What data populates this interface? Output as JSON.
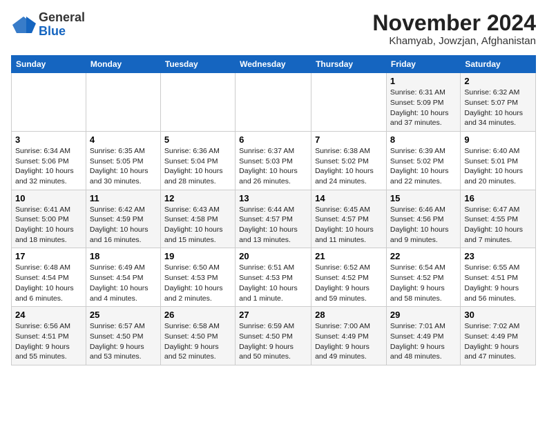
{
  "logo": {
    "general": "General",
    "blue": "Blue"
  },
  "header": {
    "month": "November 2024",
    "location": "Khamyab, Jowzjan, Afghanistan"
  },
  "weekdays": [
    "Sunday",
    "Monday",
    "Tuesday",
    "Wednesday",
    "Thursday",
    "Friday",
    "Saturday"
  ],
  "weeks": [
    [
      {
        "day": "",
        "info": ""
      },
      {
        "day": "",
        "info": ""
      },
      {
        "day": "",
        "info": ""
      },
      {
        "day": "",
        "info": ""
      },
      {
        "day": "",
        "info": ""
      },
      {
        "day": "1",
        "info": "Sunrise: 6:31 AM\nSunset: 5:09 PM\nDaylight: 10 hours and 37 minutes."
      },
      {
        "day": "2",
        "info": "Sunrise: 6:32 AM\nSunset: 5:07 PM\nDaylight: 10 hours and 34 minutes."
      }
    ],
    [
      {
        "day": "3",
        "info": "Sunrise: 6:34 AM\nSunset: 5:06 PM\nDaylight: 10 hours and 32 minutes."
      },
      {
        "day": "4",
        "info": "Sunrise: 6:35 AM\nSunset: 5:05 PM\nDaylight: 10 hours and 30 minutes."
      },
      {
        "day": "5",
        "info": "Sunrise: 6:36 AM\nSunset: 5:04 PM\nDaylight: 10 hours and 28 minutes."
      },
      {
        "day": "6",
        "info": "Sunrise: 6:37 AM\nSunset: 5:03 PM\nDaylight: 10 hours and 26 minutes."
      },
      {
        "day": "7",
        "info": "Sunrise: 6:38 AM\nSunset: 5:02 PM\nDaylight: 10 hours and 24 minutes."
      },
      {
        "day": "8",
        "info": "Sunrise: 6:39 AM\nSunset: 5:02 PM\nDaylight: 10 hours and 22 minutes."
      },
      {
        "day": "9",
        "info": "Sunrise: 6:40 AM\nSunset: 5:01 PM\nDaylight: 10 hours and 20 minutes."
      }
    ],
    [
      {
        "day": "10",
        "info": "Sunrise: 6:41 AM\nSunset: 5:00 PM\nDaylight: 10 hours and 18 minutes."
      },
      {
        "day": "11",
        "info": "Sunrise: 6:42 AM\nSunset: 4:59 PM\nDaylight: 10 hours and 16 minutes."
      },
      {
        "day": "12",
        "info": "Sunrise: 6:43 AM\nSunset: 4:58 PM\nDaylight: 10 hours and 15 minutes."
      },
      {
        "day": "13",
        "info": "Sunrise: 6:44 AM\nSunset: 4:57 PM\nDaylight: 10 hours and 13 minutes."
      },
      {
        "day": "14",
        "info": "Sunrise: 6:45 AM\nSunset: 4:57 PM\nDaylight: 10 hours and 11 minutes."
      },
      {
        "day": "15",
        "info": "Sunrise: 6:46 AM\nSunset: 4:56 PM\nDaylight: 10 hours and 9 minutes."
      },
      {
        "day": "16",
        "info": "Sunrise: 6:47 AM\nSunset: 4:55 PM\nDaylight: 10 hours and 7 minutes."
      }
    ],
    [
      {
        "day": "17",
        "info": "Sunrise: 6:48 AM\nSunset: 4:54 PM\nDaylight: 10 hours and 6 minutes."
      },
      {
        "day": "18",
        "info": "Sunrise: 6:49 AM\nSunset: 4:54 PM\nDaylight: 10 hours and 4 minutes."
      },
      {
        "day": "19",
        "info": "Sunrise: 6:50 AM\nSunset: 4:53 PM\nDaylight: 10 hours and 2 minutes."
      },
      {
        "day": "20",
        "info": "Sunrise: 6:51 AM\nSunset: 4:53 PM\nDaylight: 10 hours and 1 minute."
      },
      {
        "day": "21",
        "info": "Sunrise: 6:52 AM\nSunset: 4:52 PM\nDaylight: 9 hours and 59 minutes."
      },
      {
        "day": "22",
        "info": "Sunrise: 6:54 AM\nSunset: 4:52 PM\nDaylight: 9 hours and 58 minutes."
      },
      {
        "day": "23",
        "info": "Sunrise: 6:55 AM\nSunset: 4:51 PM\nDaylight: 9 hours and 56 minutes."
      }
    ],
    [
      {
        "day": "24",
        "info": "Sunrise: 6:56 AM\nSunset: 4:51 PM\nDaylight: 9 hours and 55 minutes."
      },
      {
        "day": "25",
        "info": "Sunrise: 6:57 AM\nSunset: 4:50 PM\nDaylight: 9 hours and 53 minutes."
      },
      {
        "day": "26",
        "info": "Sunrise: 6:58 AM\nSunset: 4:50 PM\nDaylight: 9 hours and 52 minutes."
      },
      {
        "day": "27",
        "info": "Sunrise: 6:59 AM\nSunset: 4:50 PM\nDaylight: 9 hours and 50 minutes."
      },
      {
        "day": "28",
        "info": "Sunrise: 7:00 AM\nSunset: 4:49 PM\nDaylight: 9 hours and 49 minutes."
      },
      {
        "day": "29",
        "info": "Sunrise: 7:01 AM\nSunset: 4:49 PM\nDaylight: 9 hours and 48 minutes."
      },
      {
        "day": "30",
        "info": "Sunrise: 7:02 AM\nSunset: 4:49 PM\nDaylight: 9 hours and 47 minutes."
      }
    ]
  ]
}
